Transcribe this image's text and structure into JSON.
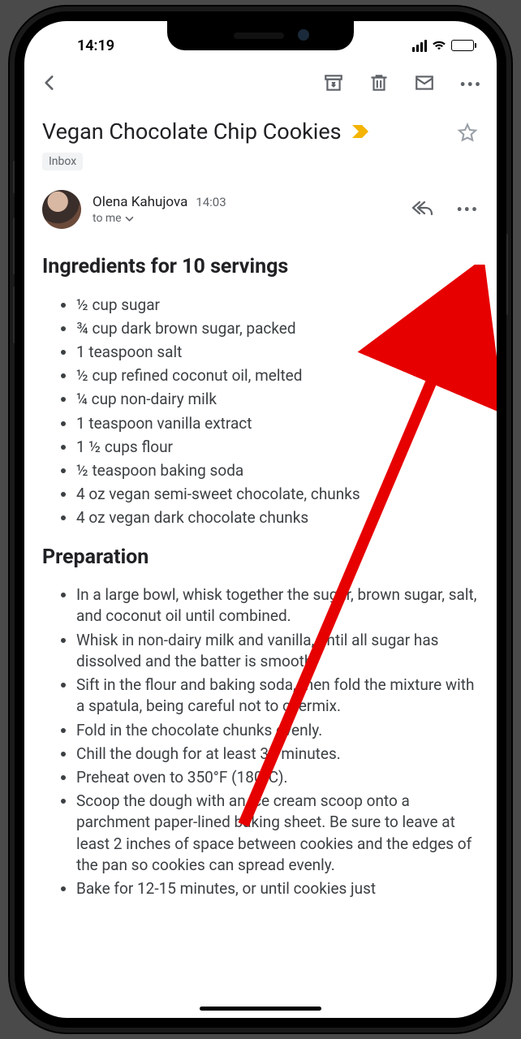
{
  "status": {
    "time": "14:19"
  },
  "subject": "Vegan Chocolate Chip Cookies",
  "label": "Inbox",
  "sender": {
    "name": "Olena Kahujova",
    "time": "14:03",
    "to": "to me"
  },
  "content": {
    "ingredients_heading": "Ingredients for 10 servings",
    "ingredients": [
      "½ cup sugar",
      "¾ cup dark brown sugar, packed",
      "1 teaspoon salt",
      "½ cup refined coconut oil, melted",
      "¼ cup non-dairy milk",
      "1 teaspoon vanilla extract",
      "1 ½ cups flour",
      "½ teaspoon baking soda",
      "4 oz vegan semi-sweet chocolate, chunks",
      "4 oz vegan dark chocolate chunks"
    ],
    "prep_heading": "Preparation",
    "prep": [
      "In a large bowl, whisk together the sugar, brown sugar, salt, and coconut oil until combined.",
      "Whisk in non-dairy milk and vanilla, until all sugar has dissolved and the batter is smooth.",
      "Sift in the flour and baking soda, then fold the mixture with a spatula, being careful not to overmix.",
      "Fold in the chocolate chunks evenly.",
      "Chill the dough for at least 30 minutes.",
      "Preheat oven to 350°F (180°C).",
      "Scoop the dough with an ice cream scoop onto a parchment paper-lined baking sheet. Be sure to leave at least 2 inches of space between cookies and the edges of the pan so cookies can spread evenly.",
      "Bake for 12-15 minutes, or until cookies just"
    ]
  },
  "annotation": {
    "target": "message-more-button"
  }
}
